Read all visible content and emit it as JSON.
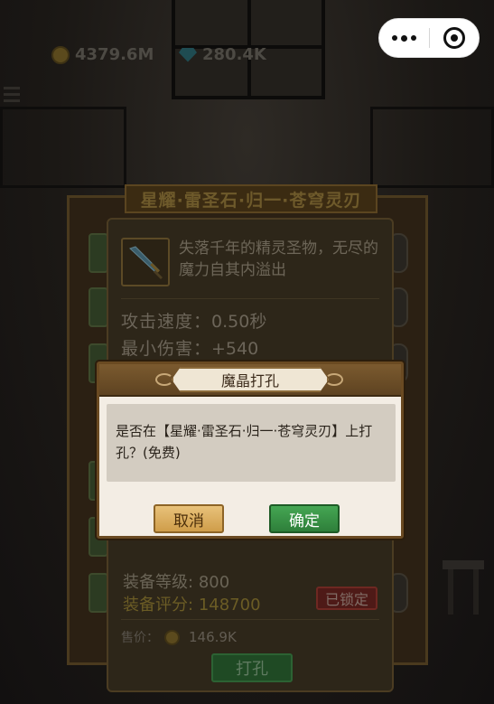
{
  "topbar": {
    "gold": {
      "icon": "gold-coin-icon",
      "value": "4379.6M"
    },
    "gems": {
      "icon": "diamond-icon",
      "value": "280.4K"
    }
  },
  "capsule": {
    "more_icon": "more-dots-icon",
    "close_icon": "close-target-icon"
  },
  "equipment_panel": {
    "title": "星耀·雷圣石·归一·苍穹灵刃"
  },
  "item_detail": {
    "icon": "sword-icon",
    "description": "失落千年的精灵圣物，无尽的魔力自其内溢出",
    "stats": [
      {
        "label": "攻击速度：",
        "value": "0.50秒"
      },
      {
        "label": "最小伤害：",
        "value": "+540"
      }
    ],
    "level_label": "装备等级:",
    "level_value": "800",
    "score_label": "装备评分:",
    "score_value": "148700",
    "locked_badge": "已锁定",
    "price_label": "售价：",
    "price_value": "146.9K",
    "drill_button": "打孔"
  },
  "dialog": {
    "title": "魔晶打孔",
    "message": "是否在【星耀·雷圣石·归一·苍穹灵刃】上打孔？(免费)",
    "cancel": "取消",
    "confirm": "确定"
  },
  "colors": {
    "cancel_button": "#cf9d4a",
    "confirm_button": "#2e7f3a",
    "dialog_frame": "#6a4a22",
    "locked_badge": "#4e1a17"
  }
}
